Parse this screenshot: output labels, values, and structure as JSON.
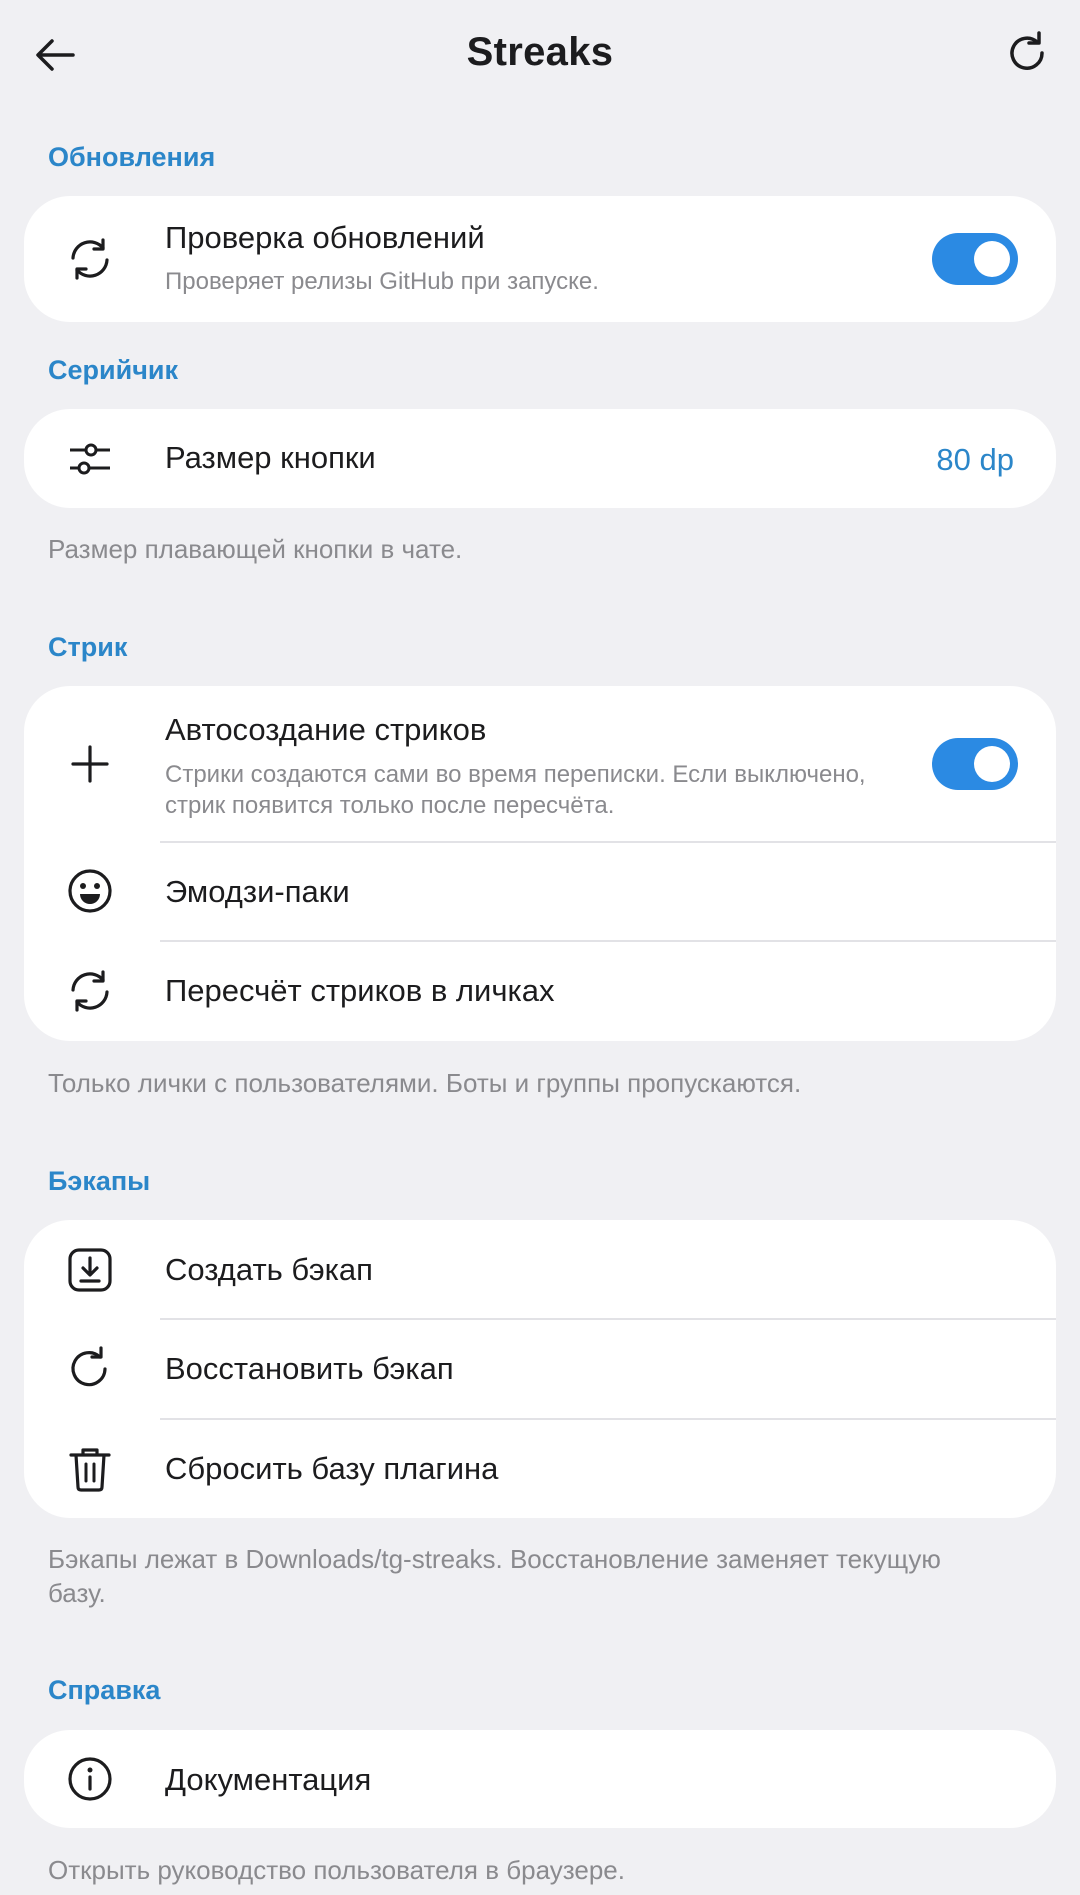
{
  "header": {
    "title": "Streaks",
    "back_icon": "arrow-left-icon",
    "refresh_icon": "refresh-icon"
  },
  "updates": {
    "section_title": "Обновления",
    "check_updates": {
      "label": "Проверка обновлений",
      "description": "Проверяет релизы GitHub при запуске.",
      "enabled": true,
      "icon": "sync-icon"
    }
  },
  "serial": {
    "section_title": "Серийчик",
    "button_size": {
      "label": "Размер кнопки",
      "value": "80 dp",
      "icon": "sliders-icon"
    },
    "footnote": "Размер плавающей кнопки в чате."
  },
  "streak": {
    "section_title": "Стрик",
    "auto_create": {
      "label": "Автосоздание стриков",
      "description_line1": "Стрики создаются сами во время переписки. Если выключено,",
      "description_line2": "стрик появится только после пересчёта.",
      "enabled": true,
      "icon": "plus-icon"
    },
    "emoji_packs": {
      "label": "Эмодзи-паки",
      "icon": "smiley-icon"
    },
    "recount": {
      "label": "Пересчёт стриков в личках",
      "icon": "sync-icon"
    },
    "footnote": "Только лички с пользователями. Боты и группы пропускаются."
  },
  "backups": {
    "section_title": "Бэкапы",
    "create": {
      "label": "Создать бэкап",
      "icon": "download-icon"
    },
    "restore": {
      "label": "Восстановить бэкап",
      "icon": "restore-icon"
    },
    "reset": {
      "label": "Сбросить базу плагина",
      "icon": "trash-icon"
    },
    "footnote_line1": "Бэкапы лежат в Downloads/tg-streaks. Восстановление заменяет текущую",
    "footnote_line2": "базу."
  },
  "help": {
    "section_title": "Справка",
    "docs": {
      "label": "Документация",
      "icon": "info-icon"
    },
    "footnote": "Открыть руководство пользователя в браузере."
  },
  "colors": {
    "accent": "#2b86c9",
    "toggle_on": "#2b8ae3",
    "background": "#f0f0f3",
    "card": "#ffffff",
    "secondary_text": "#8a8a8e"
  }
}
